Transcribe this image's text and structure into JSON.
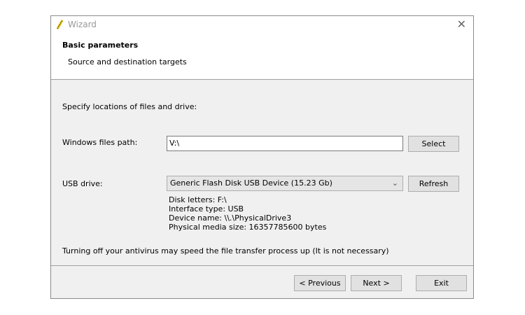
{
  "window": {
    "title": "Wizard"
  },
  "header": {
    "title": "Basic parameters",
    "subtitle": "Source and destination targets"
  },
  "main": {
    "intro": "Specify locations of files and drive:",
    "files_label": "Windows files path:",
    "files_value": "V:\\",
    "select_label": "Select",
    "usb_label": "USB drive:",
    "usb_selected": "Generic Flash Disk USB Device (15.23 Gb)",
    "refresh_label": "Refresh",
    "info": [
      "Disk letters: F:\\",
      "Interface type: USB",
      "Device name: \\\\.\\PhysicalDrive3",
      "Physical media size: 16357785600 bytes"
    ],
    "note": "Turning off your antivirus may speed the file transfer process up (It is not necessary)"
  },
  "footer": {
    "previous": "< Previous",
    "next": "Next >",
    "exit": "Exit"
  }
}
